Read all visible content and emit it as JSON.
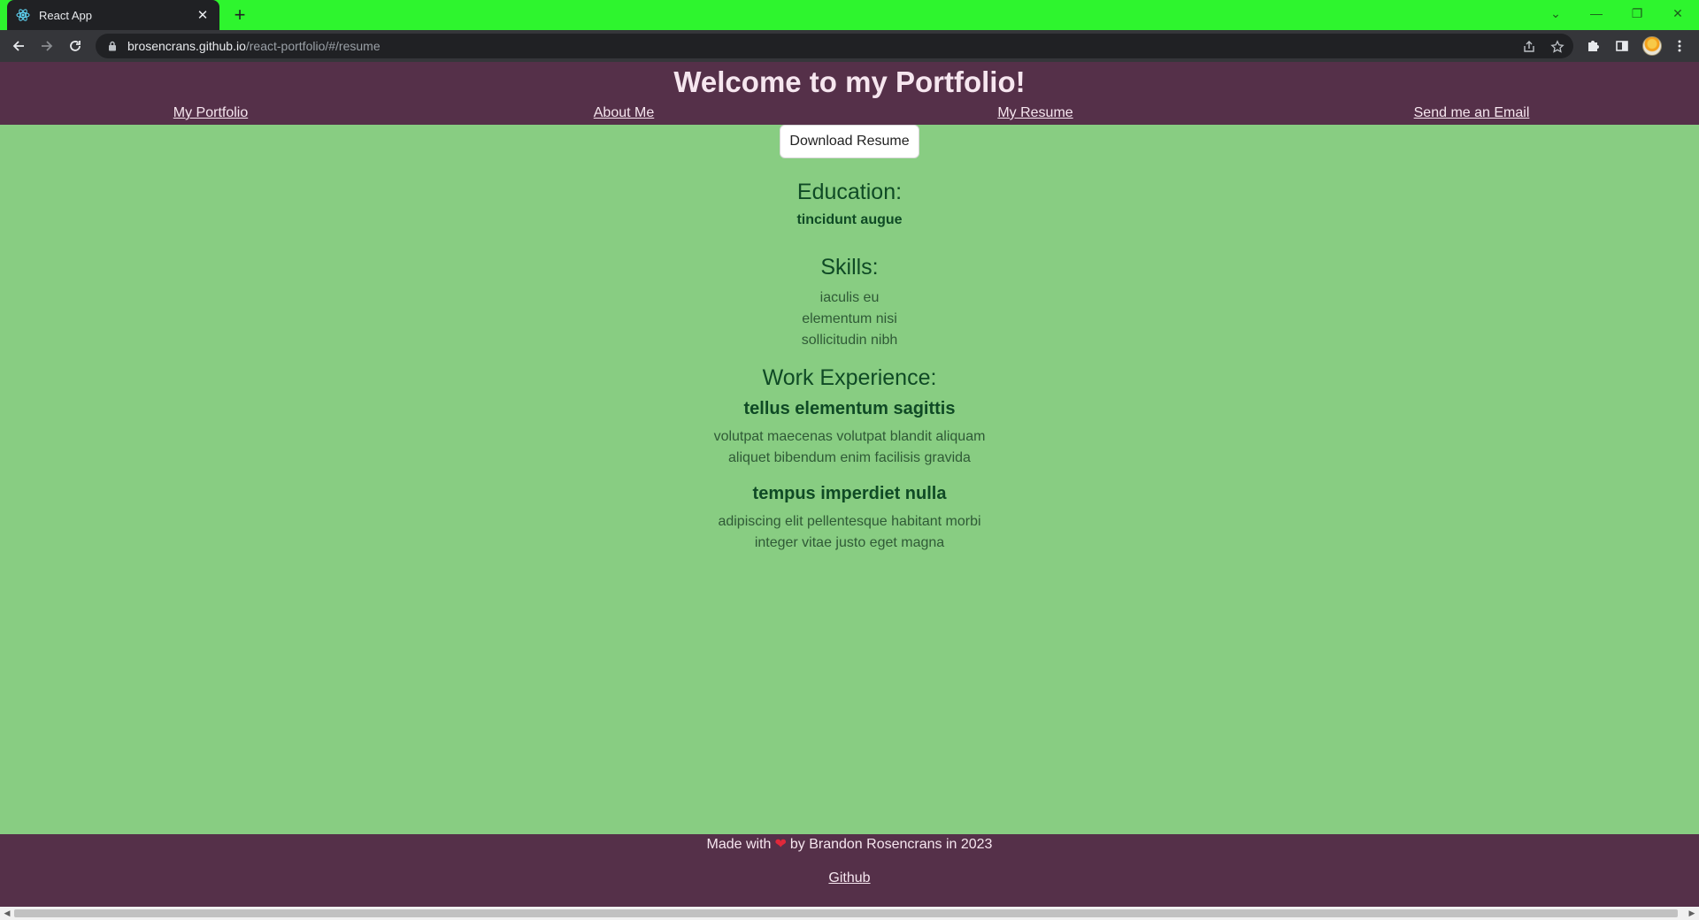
{
  "browser": {
    "tab_title": "React App",
    "url_host": "brosencrans.github.io",
    "url_path": "/react-portfolio/#/resume",
    "accent_color": "#2ef52e"
  },
  "header": {
    "title": "Welcome to my Portfolio!",
    "nav": [
      {
        "label": "My Portfolio"
      },
      {
        "label": "About Me"
      },
      {
        "label": "My Resume"
      },
      {
        "label": "Send me an Email"
      }
    ]
  },
  "resume": {
    "download_label": "Download Resume",
    "education_heading": "Education:",
    "education_items": [
      "tincidunt augue"
    ],
    "skills_heading": "Skills:",
    "skills": [
      "iaculis eu",
      "elementum nisi",
      "sollicitudin nibh"
    ],
    "work_heading": "Work Experience:",
    "jobs": [
      {
        "title": "tellus elementum sagittis",
        "lines": [
          "volutpat maecenas volutpat blandit aliquam",
          "aliquet bibendum enim facilisis gravida"
        ]
      },
      {
        "title": "tempus imperdiet nulla",
        "lines": [
          "adipiscing elit pellentesque habitant morbi",
          "integer vitae justo eget magna"
        ]
      }
    ]
  },
  "footer": {
    "made_with": "Made with",
    "by_line": "by Brandon Rosencrans in 2023",
    "github_label": "Github"
  },
  "colors": {
    "header_bg": "#553049",
    "page_bg": "#88cd82",
    "heading_text": "#0f4a25"
  }
}
